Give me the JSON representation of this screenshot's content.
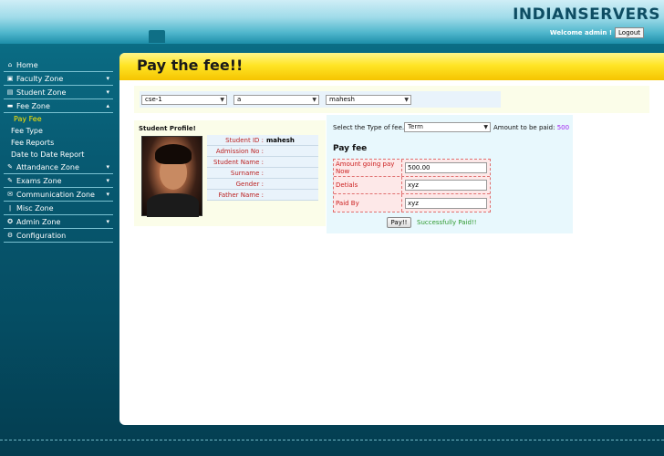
{
  "header": {
    "logo_text": "INDIANSERVERS",
    "welcome_text": "Welcome admin !",
    "logout_label": "Logout"
  },
  "sidebar": {
    "items": [
      {
        "label": "Home",
        "icon": "home-icon"
      },
      {
        "label": "Faculty Zone",
        "icon": "faculty-icon"
      },
      {
        "label": "Student Zone",
        "icon": "student-icon"
      },
      {
        "label": "Fee Zone",
        "icon": "fee-icon"
      },
      {
        "label": "Attandance Zone",
        "icon": "attendance-icon"
      },
      {
        "label": "Exams Zone",
        "icon": "exams-icon"
      },
      {
        "label": "Communication Zone",
        "icon": "communication-icon"
      },
      {
        "label": "Misc Zone",
        "icon": "misc-icon"
      },
      {
        "label": "Admin Zone",
        "icon": "admin-icon"
      },
      {
        "label": "Configuration",
        "icon": "configuration-icon"
      }
    ],
    "fee_sub_items": [
      "Pay Fee",
      "Fee Type",
      "Fee Reports",
      "Date to Date Report"
    ]
  },
  "main": {
    "title": "Pay the fee!!",
    "filters": {
      "branch": "cse-1",
      "section": "a",
      "student": "mahesh"
    },
    "profile": {
      "title": "Student Profile!",
      "fields": [
        {
          "label": "Student ID :",
          "value": "mahesh"
        },
        {
          "label": "Admission No :",
          "value": ""
        },
        {
          "label": "Student Name :",
          "value": ""
        },
        {
          "label": "Surname :",
          "value": ""
        },
        {
          "label": "Gender :",
          "value": ""
        },
        {
          "label": "Father Name :",
          "value": ""
        }
      ]
    },
    "fee": {
      "type_label": "Select the Type of fee.",
      "type_value": "Term",
      "amount_label": "Amount to be paid:",
      "amount_value": "500",
      "section_title": "Pay fee",
      "rows": [
        {
          "label": "Amount going pay Now",
          "value": "500.00"
        },
        {
          "label": "Detials",
          "value": "xyz"
        },
        {
          "label": "Paid By",
          "value": "xyz"
        }
      ],
      "pay_label": "Pay!!",
      "success_text": "Successfully Paid!!"
    }
  },
  "colors": {
    "title_bar": "#ffe526",
    "success": "#2f9a2f",
    "amount": "#a020f0",
    "field_label": "#c22222"
  }
}
